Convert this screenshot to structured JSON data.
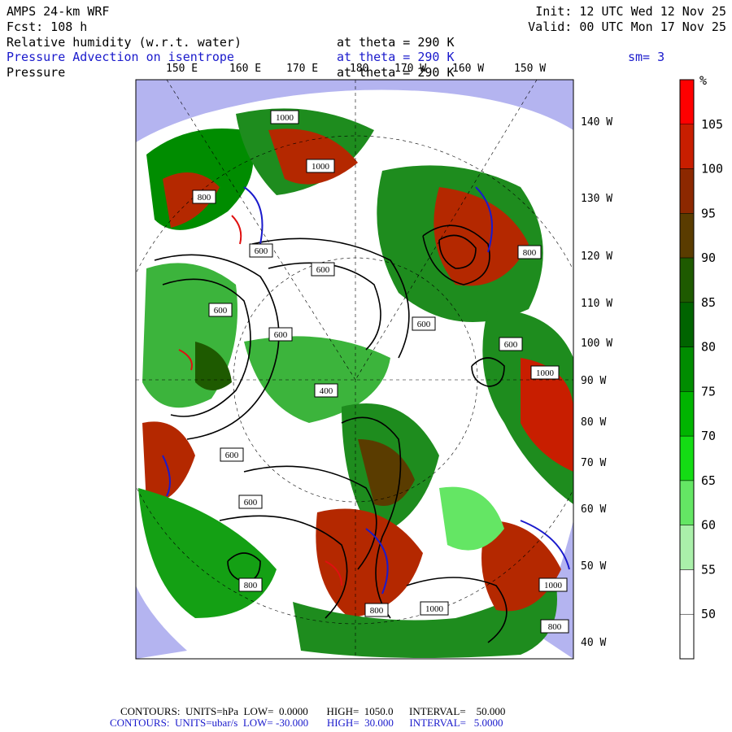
{
  "header": {
    "model": "AMPS 24-km WRF",
    "fcst": "Fcst:  108 h",
    "init": "Init: 12 UTC Wed 12 Nov 25",
    "valid": "Valid: 00 UTC Mon 17 Nov 25",
    "fields": [
      {
        "label": "Relative humidity (w.r.t. water)",
        "level": "at theta = 290 K",
        "color": "#000000"
      },
      {
        "label": "Pressure Advection on isentrope",
        "level": "at theta = 290 K",
        "color": "#1a1acc"
      },
      {
        "label": "Pressure",
        "level": "at theta = 290 K",
        "color": "#000000"
      }
    ],
    "smoothing": "sm= 3"
  },
  "map": {
    "top_lon_labels": [
      "150 E",
      "160 E",
      "170 E",
      "180",
      "170 W",
      "160 W",
      "150 W"
    ],
    "right_lon_labels": [
      "140 W",
      "130 W",
      "120 W",
      "110 W",
      "100 W",
      "90 W",
      "80 W",
      "70 W",
      "60 W",
      "50 W",
      "40 W"
    ],
    "contour_labels": [
      "1000",
      "1000",
      "800",
      "600",
      "600",
      "600",
      "600",
      "800",
      "600",
      "600",
      "400",
      "600",
      "600",
      "800",
      "800",
      "800",
      "1000",
      "1000",
      "1000"
    ]
  },
  "colorbar": {
    "unit": "%",
    "labels": [
      "105",
      "100",
      "95",
      "90",
      "85",
      "80",
      "75",
      "70",
      "65",
      "60",
      "55",
      "50"
    ],
    "colors": [
      "#ff0000",
      "#c81e00",
      "#8c2800",
      "#5a3c00",
      "#1e5a00",
      "#006400",
      "#008c00",
      "#00b400",
      "#14dc14",
      "#64e664",
      "#aaf0aa",
      "#ffffff",
      "#ffffff"
    ]
  },
  "footer": {
    "line1": "CONTOURS:  UNITS=hPa  LOW=  0.0000       HIGH=  1050.0      INTERVAL=    50.000",
    "line2": "CONTOURS:  UNITS=ubar/s  LOW= -30.000       HIGH=  30.000      INTERVAL=   5.0000"
  }
}
